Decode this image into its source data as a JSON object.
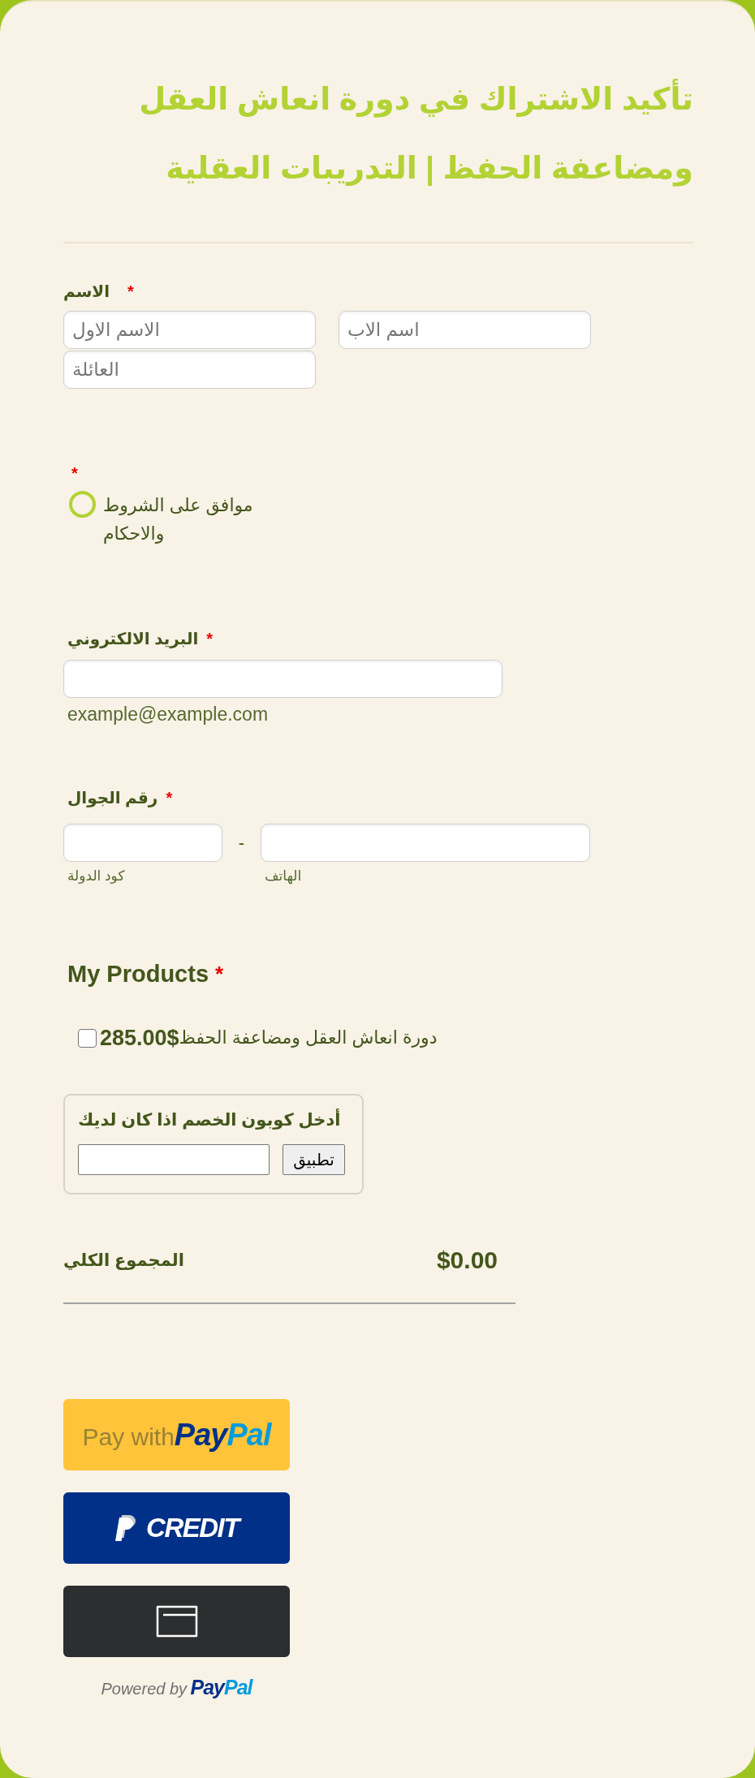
{
  "title": "تأكيد الاشتراك في دورة انعاش العقل ومضاعفة الحفظ | التدريبات العقلية",
  "name_field": {
    "label": "الاسم",
    "required_mark": "*",
    "inputs": [
      {
        "placeholder": "الاسم الاول"
      },
      {
        "placeholder": "اسم الاب"
      },
      {
        "placeholder": "العائلة"
      }
    ]
  },
  "terms": {
    "required_mark": "*",
    "label": "موافق على الشروط والاحكام",
    "checked": false
  },
  "email_field": {
    "label": "البريد الالكتروني",
    "required_mark": "*",
    "sublabel": "example@example.com"
  },
  "phone_field": {
    "label": "رقم الجوال",
    "required_mark": "*",
    "separator": "-",
    "country_code": {
      "sublabel": "كود الدولة"
    },
    "number": {
      "sublabel": "الهاتف"
    }
  },
  "products": {
    "heading": "My Products",
    "required_mark": "*",
    "items": [
      {
        "price": "285.00$",
        "name": "دورة انعاش العقل ومضاعفة الحفظ",
        "checked": false
      }
    ]
  },
  "coupon": {
    "title": "أدخل كوبون الخصم اذا كان لديك",
    "button": "تطبيق"
  },
  "total": {
    "label": "المجموع الكلي",
    "amount": "$0.00"
  },
  "payment_buttons": [
    {
      "kind": "paypal",
      "label": "Pay with",
      "brand": {
        "part_1": "Pay",
        "part_2": "Pal"
      }
    },
    {
      "kind": "credit",
      "label": "CREDIT"
    },
    {
      "kind": "card"
    }
  ],
  "powered_by": {
    "text": "Powered by",
    "brand": {
      "part_1": "Pay",
      "part_2": "Pal"
    }
  }
}
